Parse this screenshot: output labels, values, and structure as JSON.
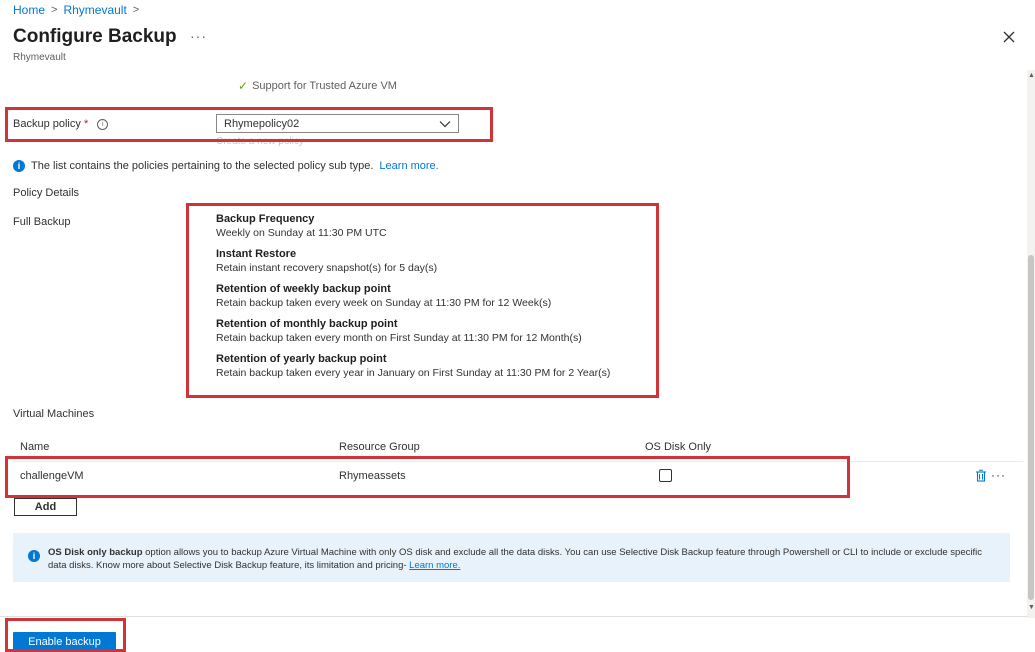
{
  "breadcrumb": {
    "home": "Home",
    "vault": "Rhymevault",
    "sep": ">"
  },
  "header": {
    "title": "Configure Backup",
    "more": "···",
    "subtitle": "Rhymevault"
  },
  "support": {
    "text": "Support for Trusted Azure VM"
  },
  "backup_policy": {
    "label": "Backup policy",
    "required_mark": "*",
    "info_glyph": "i",
    "selected": "Rhymepolicy02",
    "create_link": "Create a new policy"
  },
  "policy_info": {
    "text": "The list contains the policies pertaining to the selected policy sub type.",
    "link": "Learn more."
  },
  "policy_details": {
    "heading": "Policy Details",
    "full_backup_label": "Full Backup",
    "items": [
      {
        "title": "Backup Frequency",
        "desc": "Weekly on Sunday at 11:30 PM UTC"
      },
      {
        "title": "Instant Restore",
        "desc": "Retain instant recovery snapshot(s) for 5 day(s)"
      },
      {
        "title": "Retention of weekly backup point",
        "desc": "Retain backup taken every week on Sunday at 11:30 PM for 12 Week(s)"
      },
      {
        "title": "Retention of monthly backup point",
        "desc": "Retain backup taken every month on First Sunday at 11:30 PM for 12 Month(s)"
      },
      {
        "title": "Retention of yearly backup point",
        "desc": "Retain backup taken every year in January on First Sunday at 11:30 PM for 2 Year(s)"
      }
    ]
  },
  "vms": {
    "heading": "Virtual Machines",
    "columns": {
      "name": "Name",
      "resource_group": "Resource Group",
      "os_disk_only": "OS Disk Only"
    },
    "rows": [
      {
        "name": "challengeVM",
        "resource_group": "Rhymeassets",
        "os_disk_only": false
      }
    ],
    "row_more": "···",
    "add_label": "Add"
  },
  "os_disk_banner": {
    "bold": "OS Disk only backup",
    "text": " option allows you to backup Azure Virtual Machine with only OS disk and exclude all the data disks. You can use Selective Disk Backup feature through Powershell or CLI to include or exclude specific data disks. Know more about Selective Disk Backup feature, its limitation and pricing- ",
    "link": "Learn more."
  },
  "footer": {
    "enable_label": "Enable backup"
  },
  "colors": {
    "accent": "#0078d4",
    "highlight": "#d13438",
    "banner_bg": "#e7f2fb"
  }
}
